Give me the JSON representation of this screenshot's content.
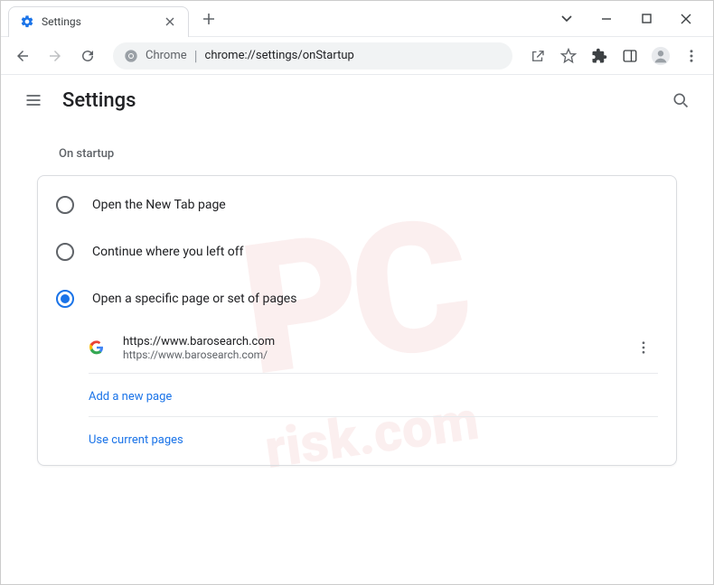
{
  "window": {
    "tab_title": "Settings"
  },
  "omnibox": {
    "prefix": "Chrome",
    "url": "chrome://settings/onStartup"
  },
  "appbar": {
    "title": "Settings"
  },
  "section": {
    "title": "On startup",
    "options": {
      "opt0": "Open the New Tab page",
      "opt1": "Continue where you left off",
      "opt2": "Open a specific page or set of pages"
    },
    "selected_index": 2,
    "pages": [
      {
        "title": "https://www.barosearch.com",
        "url": "https://www.barosearch.com/"
      }
    ],
    "add_page_label": "Add a new page",
    "use_current_label": "Use current pages"
  }
}
